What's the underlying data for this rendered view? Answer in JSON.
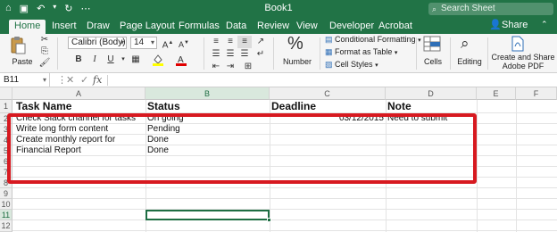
{
  "window": {
    "title": "Book1",
    "search_placeholder": "Search Sheet",
    "quick_access": [
      "home-icon",
      "save-icon",
      "undo-icon",
      "redo-icon",
      "more-icon"
    ]
  },
  "tabs": [
    "Home",
    "Insert",
    "Draw",
    "Page Layout",
    "Formulas",
    "Data",
    "Review",
    "View",
    "Developer",
    "Acrobat"
  ],
  "share_label": "Share",
  "ribbon": {
    "paste_label": "Paste",
    "font_name": "Calibri (Body)",
    "font_size": "14",
    "bold": "B",
    "italic": "I",
    "underline": "U",
    "number_label": "Number",
    "percent": "%",
    "conditional_formatting": "Conditional Formatting",
    "format_as_table": "Format as Table",
    "cell_styles": "Cell Styles",
    "cells_label": "Cells",
    "editing_label": "Editing",
    "create_share_label_1": "Create and Share",
    "create_share_label_2": "Adobe PDF"
  },
  "formula_bar": {
    "cell_ref": "B11",
    "formula": ""
  },
  "columns": [
    "A",
    "B",
    "C",
    "D",
    "E",
    "F"
  ],
  "rows": [
    "1",
    "2",
    "3",
    "4",
    "5",
    "6",
    "7",
    "8",
    "9",
    "10",
    "11",
    "12"
  ],
  "sheet": {
    "headers": [
      "Task Name",
      "Status",
      "Deadline",
      "Note"
    ],
    "data": [
      {
        "task": "Check Slack channel for tasks",
        "status": "On going",
        "deadline": "03/12/2015",
        "note": "Need to submit"
      },
      {
        "task": "Write long form content",
        "status": "Pending",
        "deadline": "",
        "note": ""
      },
      {
        "task": "Create monthly report for",
        "status": "Done",
        "deadline": "",
        "note": ""
      },
      {
        "task": "Financial Report",
        "status": "Done",
        "deadline": "",
        "note": ""
      }
    ]
  },
  "colors": {
    "excel_green": "#217346",
    "highlight_red": "#d71920"
  }
}
